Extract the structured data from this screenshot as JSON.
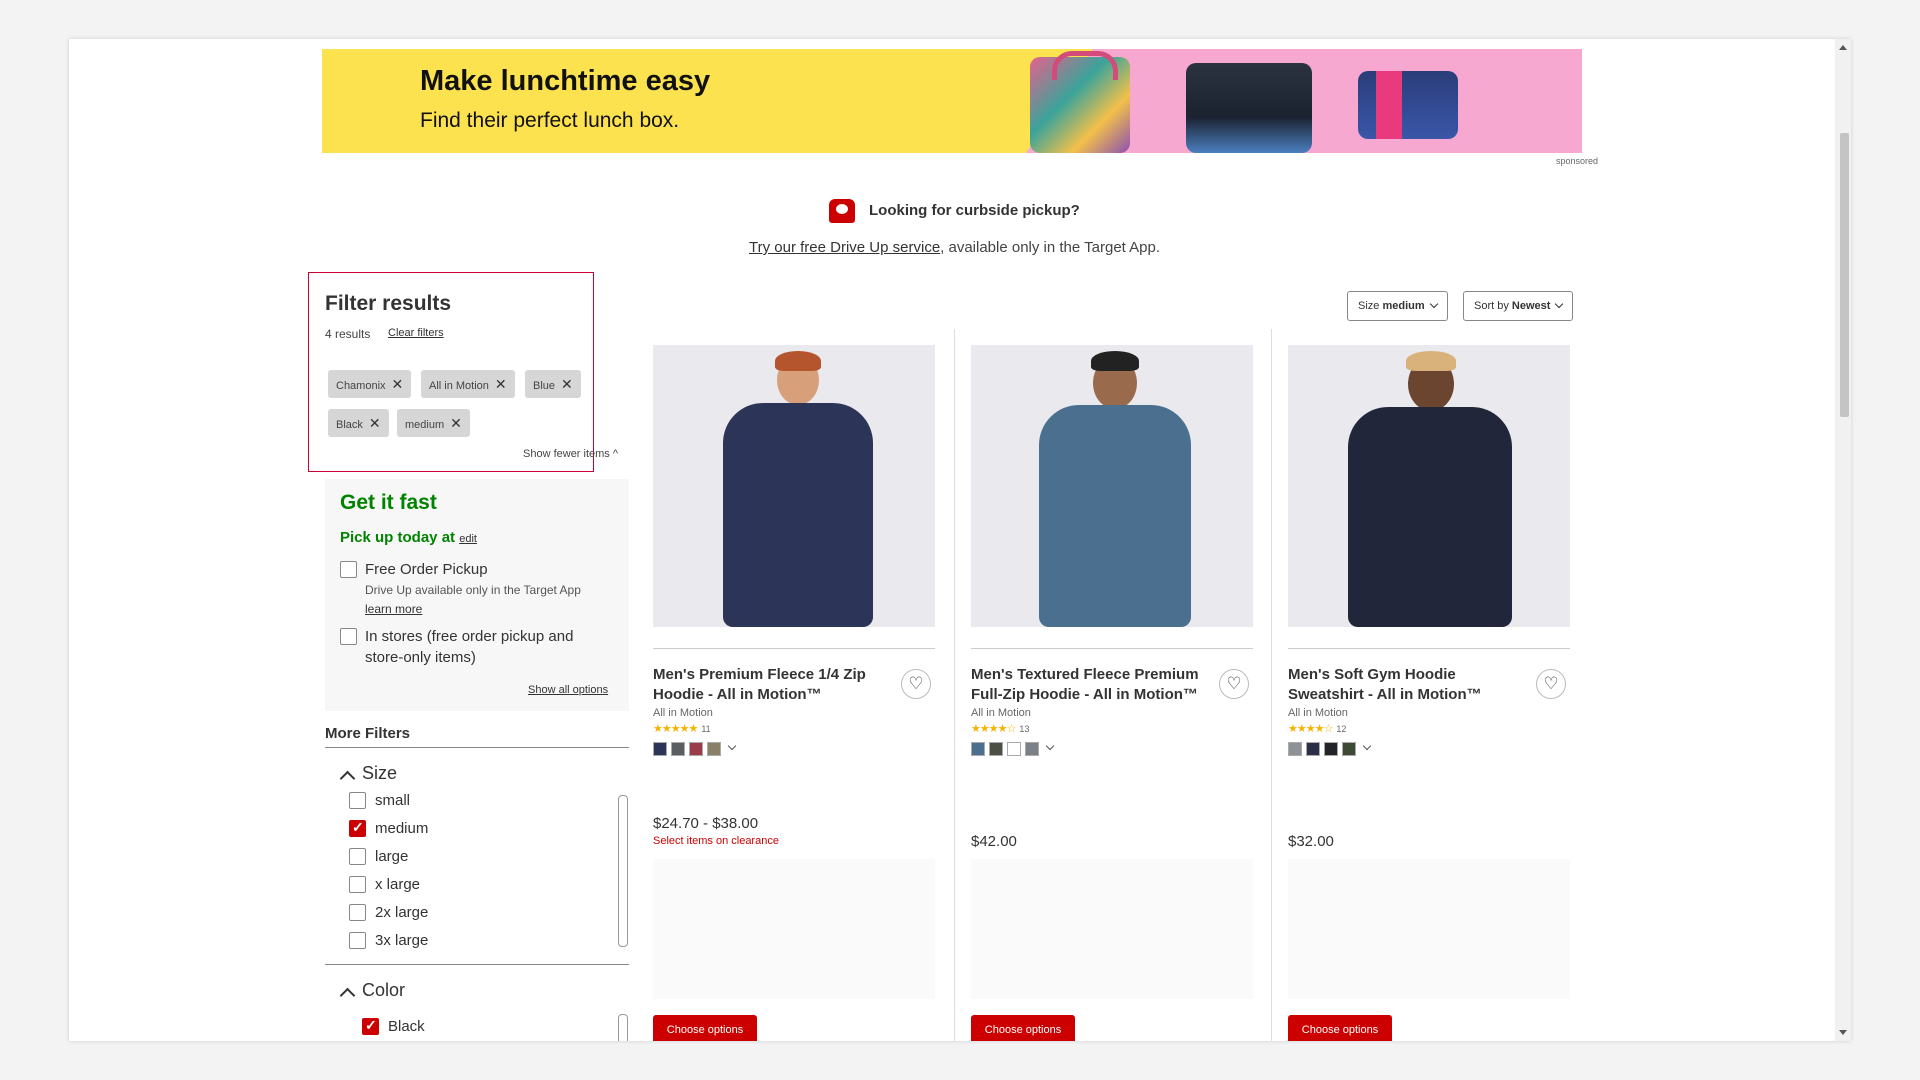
{
  "banner": {
    "title": "Make lunchtime easy",
    "subtitle": "Find their perfect lunch box.",
    "sponsored": "sponsored"
  },
  "curbside": {
    "title": "Looking for curbside pickup?",
    "link": "Try our free Drive Up service",
    "rest": ", available only in the Target App."
  },
  "filters": {
    "title": "Filter results",
    "count": "4 results",
    "clear": "Clear filters",
    "chips": [
      "Chamonix",
      "All in Motion",
      "Blue",
      "Black",
      "medium"
    ],
    "show_fewer": "Show fewer items ^"
  },
  "fast": {
    "title": "Get it fast",
    "pickup": "Pick up today at",
    "edit": "edit",
    "free_pickup": "Free Order Pickup",
    "drive_up_note": "Drive Up available only in the Target App",
    "learn_more": "learn more",
    "in_stores": "In stores (free order pickup and",
    "in_stores_2": "store-only items)",
    "show_all": "Show all options"
  },
  "more_filters": {
    "title": "More Filters",
    "size_label": "Size",
    "sizes": [
      {
        "label": "small",
        "checked": false
      },
      {
        "label": "medium",
        "checked": true
      },
      {
        "label": "large",
        "checked": false
      },
      {
        "label": "x large",
        "checked": false
      },
      {
        "label": "2x large",
        "checked": false
      },
      {
        "label": "3x large",
        "checked": false
      }
    ],
    "color_label": "Color",
    "colors": [
      {
        "label": "Black",
        "checked": true
      }
    ]
  },
  "sort": {
    "size_prefix": "Size ",
    "size_value": "medium",
    "sort_prefix": "Sort by ",
    "sort_value": "Newest"
  },
  "products": [
    {
      "title": "Men's Premium Fleece 1/4 Zip Hoodie - All in Motion™",
      "brand": "All in Motion",
      "stars": "★★★★★",
      "reviews": "11",
      "swatches": [
        "#2c3557",
        "#5a5d62",
        "#9b3b4a",
        "#8a8068"
      ],
      "price": "$24.70 - $38.00",
      "clearance": "Select items on clearance",
      "button": "Choose options"
    },
    {
      "title": "Men's Textured Fleece Premium Full-Zip Hoodie - All in Motion™",
      "brand": "All in Motion",
      "stars": "★★★★☆",
      "reviews": "13",
      "swatches": [
        "#4b6f8e",
        "#4b4f44",
        "#ffffff",
        "#7c8087"
      ],
      "price": "$42.00",
      "clearance": "",
      "button": "Choose options"
    },
    {
      "title": "Men's Soft Gym Hoodie Sweatshirt - All in Motion™",
      "brand": "All in Motion",
      "stars": "★★★★☆",
      "reviews": "12",
      "swatches": [
        "#8e9196",
        "#2b2f45",
        "#222428",
        "#3f4a36"
      ],
      "price": "$32.00",
      "clearance": "",
      "button": "Choose options"
    }
  ],
  "colors": {
    "accent": "#cc0000",
    "fast_green": "#008300",
    "banner_yellow": "#fde24f",
    "banner_pink": "#f7a8d0"
  }
}
